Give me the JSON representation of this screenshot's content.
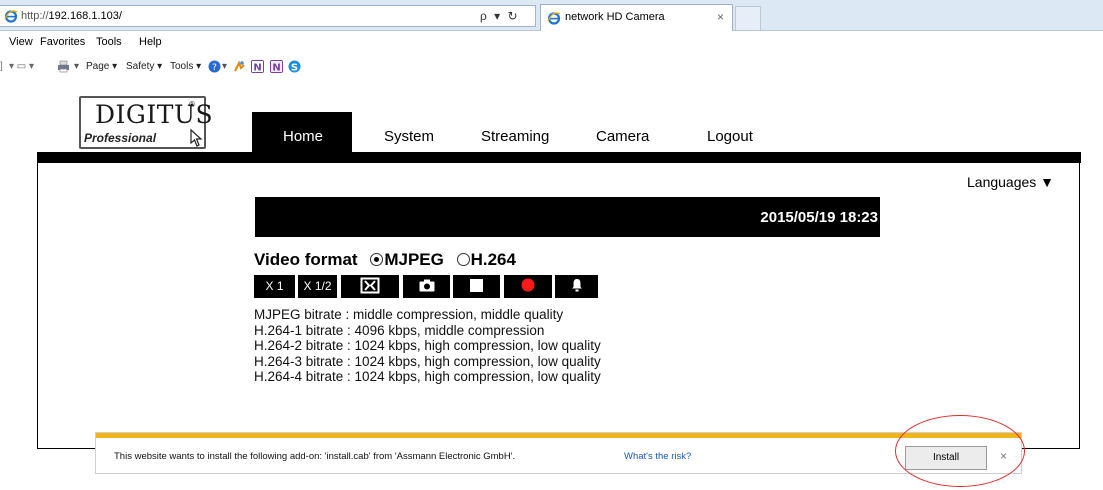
{
  "browser": {
    "url_prefix": "http://",
    "url_host": "192.168.1.103/",
    "address_tools": "ρ ▾ ↻",
    "tab_title": "network HD Camera",
    "tab_close": "×",
    "menu": [
      "View",
      "Favorites",
      "Tools",
      "Help"
    ],
    "commands": [
      "Page ▾",
      "Safety ▾",
      "Tools ▾"
    ],
    "colors": {
      "ie_icon": "#1b74d1",
      "chrome": "#dde8f5"
    }
  },
  "page": {
    "logo": {
      "brand": "DIGITUS",
      "reg": "®",
      "sub": "Professional"
    },
    "nav": [
      "Home",
      "System",
      "Streaming",
      "Camera",
      "Logout"
    ],
    "active_nav": "Home",
    "languages": "Languages ▼",
    "datetime": "2015/05/19 18:23",
    "video_format": {
      "label": "Video format",
      "options": [
        "MJPEG",
        "H.264"
      ],
      "selected": "MJPEG"
    },
    "controls": [
      "X 1",
      "X 1/2"
    ],
    "control_icons": [
      "fit-screen-icon",
      "snapshot-camera-icon",
      "stop-icon",
      "record-icon",
      "alarm-bell-icon"
    ],
    "bitrates": [
      "MJPEG bitrate : middle compression, middle quality",
      "H.264-1 bitrate : 4096 kbps, middle compression",
      "H.264-2 bitrate : 1024 kbps, high compression, low quality",
      "H.264-3 bitrate : 1024 kbps, high compression, low quality",
      "H.264-4 bitrate : 1024 kbps, high compression, low quality"
    ]
  },
  "notification": {
    "message": "This website wants to install the following add-on: 'install.cab' from 'Assmann Electronic GmbH'.",
    "link": "What's the risk?",
    "install_label": "Install",
    "close": "×",
    "accent": "#f1b419",
    "highlight_color": "#e02a2a"
  }
}
